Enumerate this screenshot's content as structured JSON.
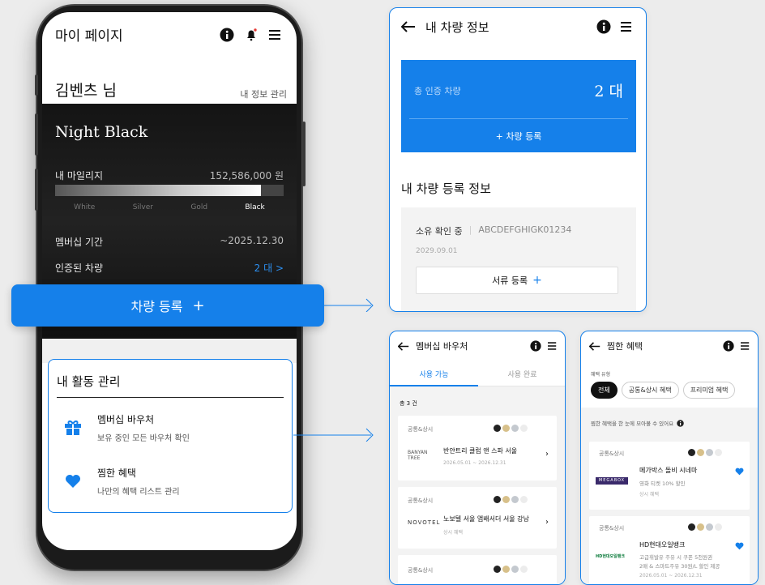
{
  "mypage": {
    "title": "마이 페이지",
    "user_name": "김벤츠 님",
    "profile_link": "내 정보 관리",
    "card": {
      "tier_name": "Night Black",
      "mileage_label": "내 마일리지",
      "mileage_value": "152,586,000 원",
      "mileage_progress": 0.9,
      "tiers": [
        "White",
        "Silver",
        "Gold",
        "Black"
      ],
      "membership_label": "멤버십 기간",
      "membership_value": "~2025.12.30",
      "cars_label": "인증된 차량",
      "cars_value": "2 대 >"
    },
    "cta_label": "차량 등록",
    "cta_icon": "+",
    "activity": {
      "title": "내 활동 관리",
      "items": [
        {
          "title": "멤버십 바우처",
          "subtitle": "보유 중인 모든 바우처 확인",
          "icon": "gift-icon"
        },
        {
          "title": "찜한 혜택",
          "subtitle": "나만의 혜택 리스트 관리",
          "icon": "heart-icon"
        }
      ]
    }
  },
  "vehicle": {
    "title": "내 차량 정보",
    "total_label": "총 인증 차량",
    "total_value": "2 대",
    "register_label": "+ 차량 등록",
    "section_title": "내 차량 등록 정보",
    "status": "소유 확인 중",
    "vin": "ABCDEFGHIGK01234",
    "date": "2029.09.01",
    "doc_button": "서류 등록",
    "doc_plus": "+"
  },
  "voucher": {
    "title": "멤버십 바우처",
    "tabs": [
      "사용 가능",
      "사용 완료"
    ],
    "count": "총 3 건",
    "items": [
      {
        "category": "공통&상시",
        "logo": "BANYAN TREE",
        "name": "반얀트리 클럽 앤 스파 서울",
        "date": "2026.05.01 ~ 2026.12.31"
      },
      {
        "category": "공통&상시",
        "logo": "NOVOTEL",
        "name": "노보텔 서울 앰배서더 서울 강남",
        "date": "상시 혜택"
      },
      {
        "category": "공통&상시"
      }
    ]
  },
  "favorites": {
    "title": "찜한 혜택",
    "filter_label": "혜택 유형",
    "chips": [
      "전체",
      "공통&상시 혜택",
      "프리미엄 혜택"
    ],
    "hint": "찜한 혜택을 한 눈에 모아볼 수 있어요",
    "items": [
      {
        "category": "공통&상시",
        "logo": "MEGABOX",
        "name": "메가박스 돌비 시네마",
        "desc1": "영화 티켓 10% 할인",
        "desc2": "상시 혜택"
      },
      {
        "category": "공통&상시",
        "logo": "HD현대오일뱅크",
        "name": "HD현대오일뱅크",
        "desc1": "고급휘발유 주유 시 쿠폰 5천원권",
        "desc2": "2매 & 스마트주유 30원/L 할인 제공",
        "date": "2026.05.01 ~ 2026.12.31"
      }
    ]
  },
  "colors": {
    "accent": "#1580ea",
    "dark": "#111111"
  }
}
